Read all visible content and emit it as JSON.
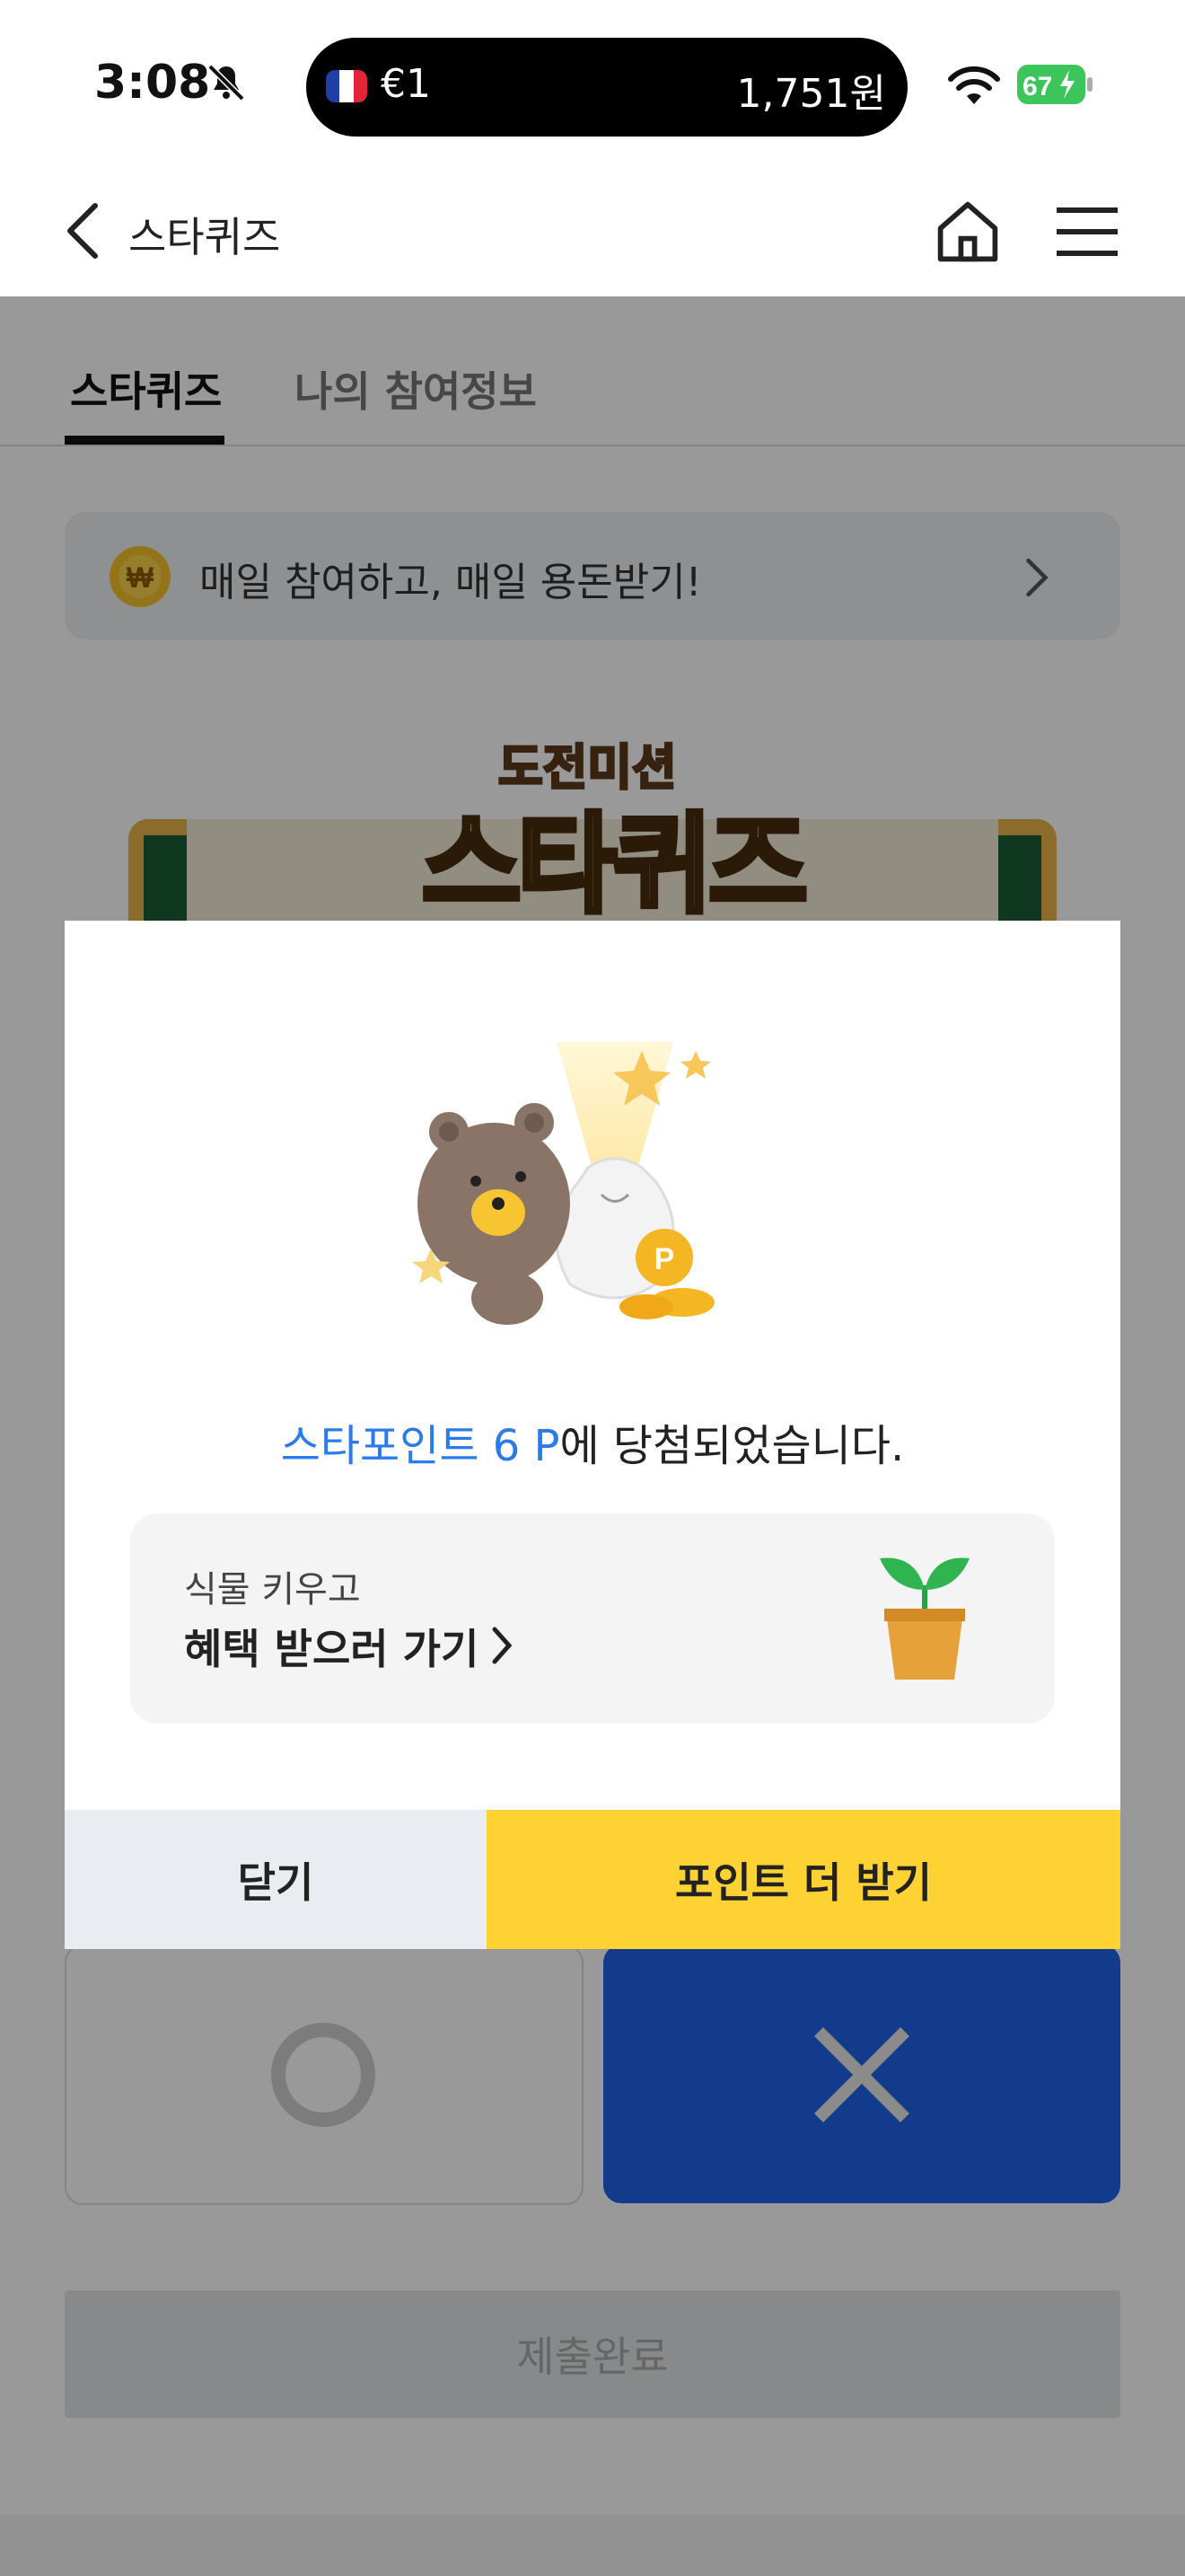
{
  "status_bar": {
    "time": "3:08",
    "ticker_left": "€1",
    "ticker_right": "1,751원",
    "battery": "67"
  },
  "header": {
    "title": "스타퀴즈"
  },
  "tabs": [
    {
      "label": "스타퀴즈",
      "active": true
    },
    {
      "label": "나의 참여정보",
      "active": false
    }
  ],
  "banner": {
    "text": "매일 참여하고, 매일 용돈받기!"
  },
  "logo": {
    "sub": "도전미션",
    "main": "스타퀴즈"
  },
  "submit": {
    "label": "제출완료"
  },
  "modal": {
    "message_highlight": "스타포인트 6 P",
    "message_rest": "에 당첨되었습니다.",
    "promo_sub": "식물 키우고",
    "promo_main": "혜택 받으러 가기",
    "close_label": "닫기",
    "more_label": "포인트 더 받기"
  },
  "colors": {
    "accent_blue": "#2b7bf0",
    "yellow_button": "#ffd234",
    "answer_x_blue": "#1f63ea"
  }
}
